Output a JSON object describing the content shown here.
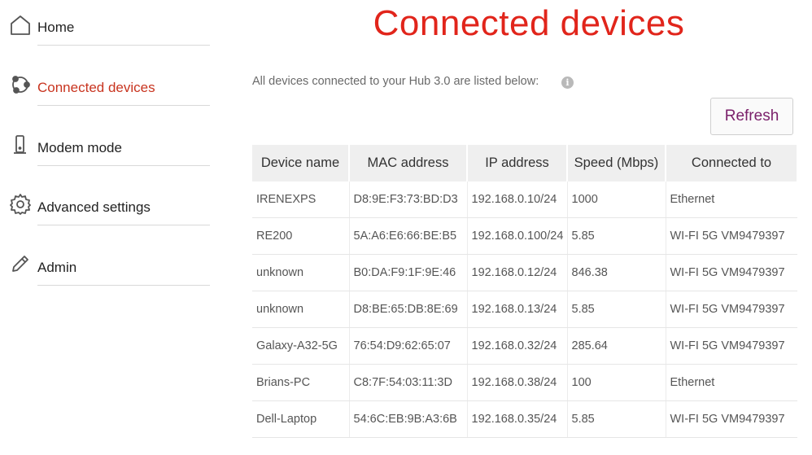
{
  "sidebar": {
    "items": [
      {
        "label": "Home",
        "icon": "home-icon",
        "active": false
      },
      {
        "label": "Connected devices",
        "icon": "connected-devices-icon",
        "active": true
      },
      {
        "label": "Modem mode",
        "icon": "modem-icon",
        "active": false
      },
      {
        "label": "Advanced settings",
        "icon": "gear-icon",
        "active": false
      },
      {
        "label": "Admin",
        "icon": "pencil-icon",
        "active": false
      }
    ]
  },
  "main": {
    "title": "Connected devices",
    "subtitle": "All devices connected to your Hub 3.0 are listed below:",
    "info_glyph": "i",
    "refresh_label": "Refresh"
  },
  "table": {
    "headers": [
      "Device name",
      "MAC address",
      "IP address",
      "Speed (Mbps)",
      "Connected to"
    ],
    "rows": [
      [
        "IRENEXPS",
        "D8:9E:F3:73:BD:D3",
        "192.168.0.10/24",
        "1000",
        "Ethernet"
      ],
      [
        "RE200",
        "5A:A6:E6:66:BE:B5",
        "192.168.0.100/24",
        "5.85",
        "WI-FI 5G VM9479397"
      ],
      [
        "unknown",
        "B0:DA:F9:1F:9E:46",
        "192.168.0.12/24",
        "846.38",
        "WI-FI 5G VM9479397"
      ],
      [
        "unknown",
        "D8:BE:65:DB:8E:69",
        "192.168.0.13/24",
        "5.85",
        "WI-FI 5G VM9479397"
      ],
      [
        "Galaxy-A32-5G",
        "76:54:D9:62:65:07",
        "192.168.0.32/24",
        "285.64",
        "WI-FI 5G VM9479397"
      ],
      [
        "Brians-PC",
        "C8:7F:54:03:11:3D",
        "192.168.0.38/24",
        "100",
        "Ethernet"
      ],
      [
        "Dell-Laptop",
        "54:6C:EB:9B:A3:6B",
        "192.168.0.35/24",
        "5.85",
        "WI-FI 5G VM9479397"
      ]
    ]
  },
  "colors": {
    "brand_red": "#e1251b",
    "active_nav": "#c8341f",
    "refresh_text": "#7a1f6a"
  }
}
